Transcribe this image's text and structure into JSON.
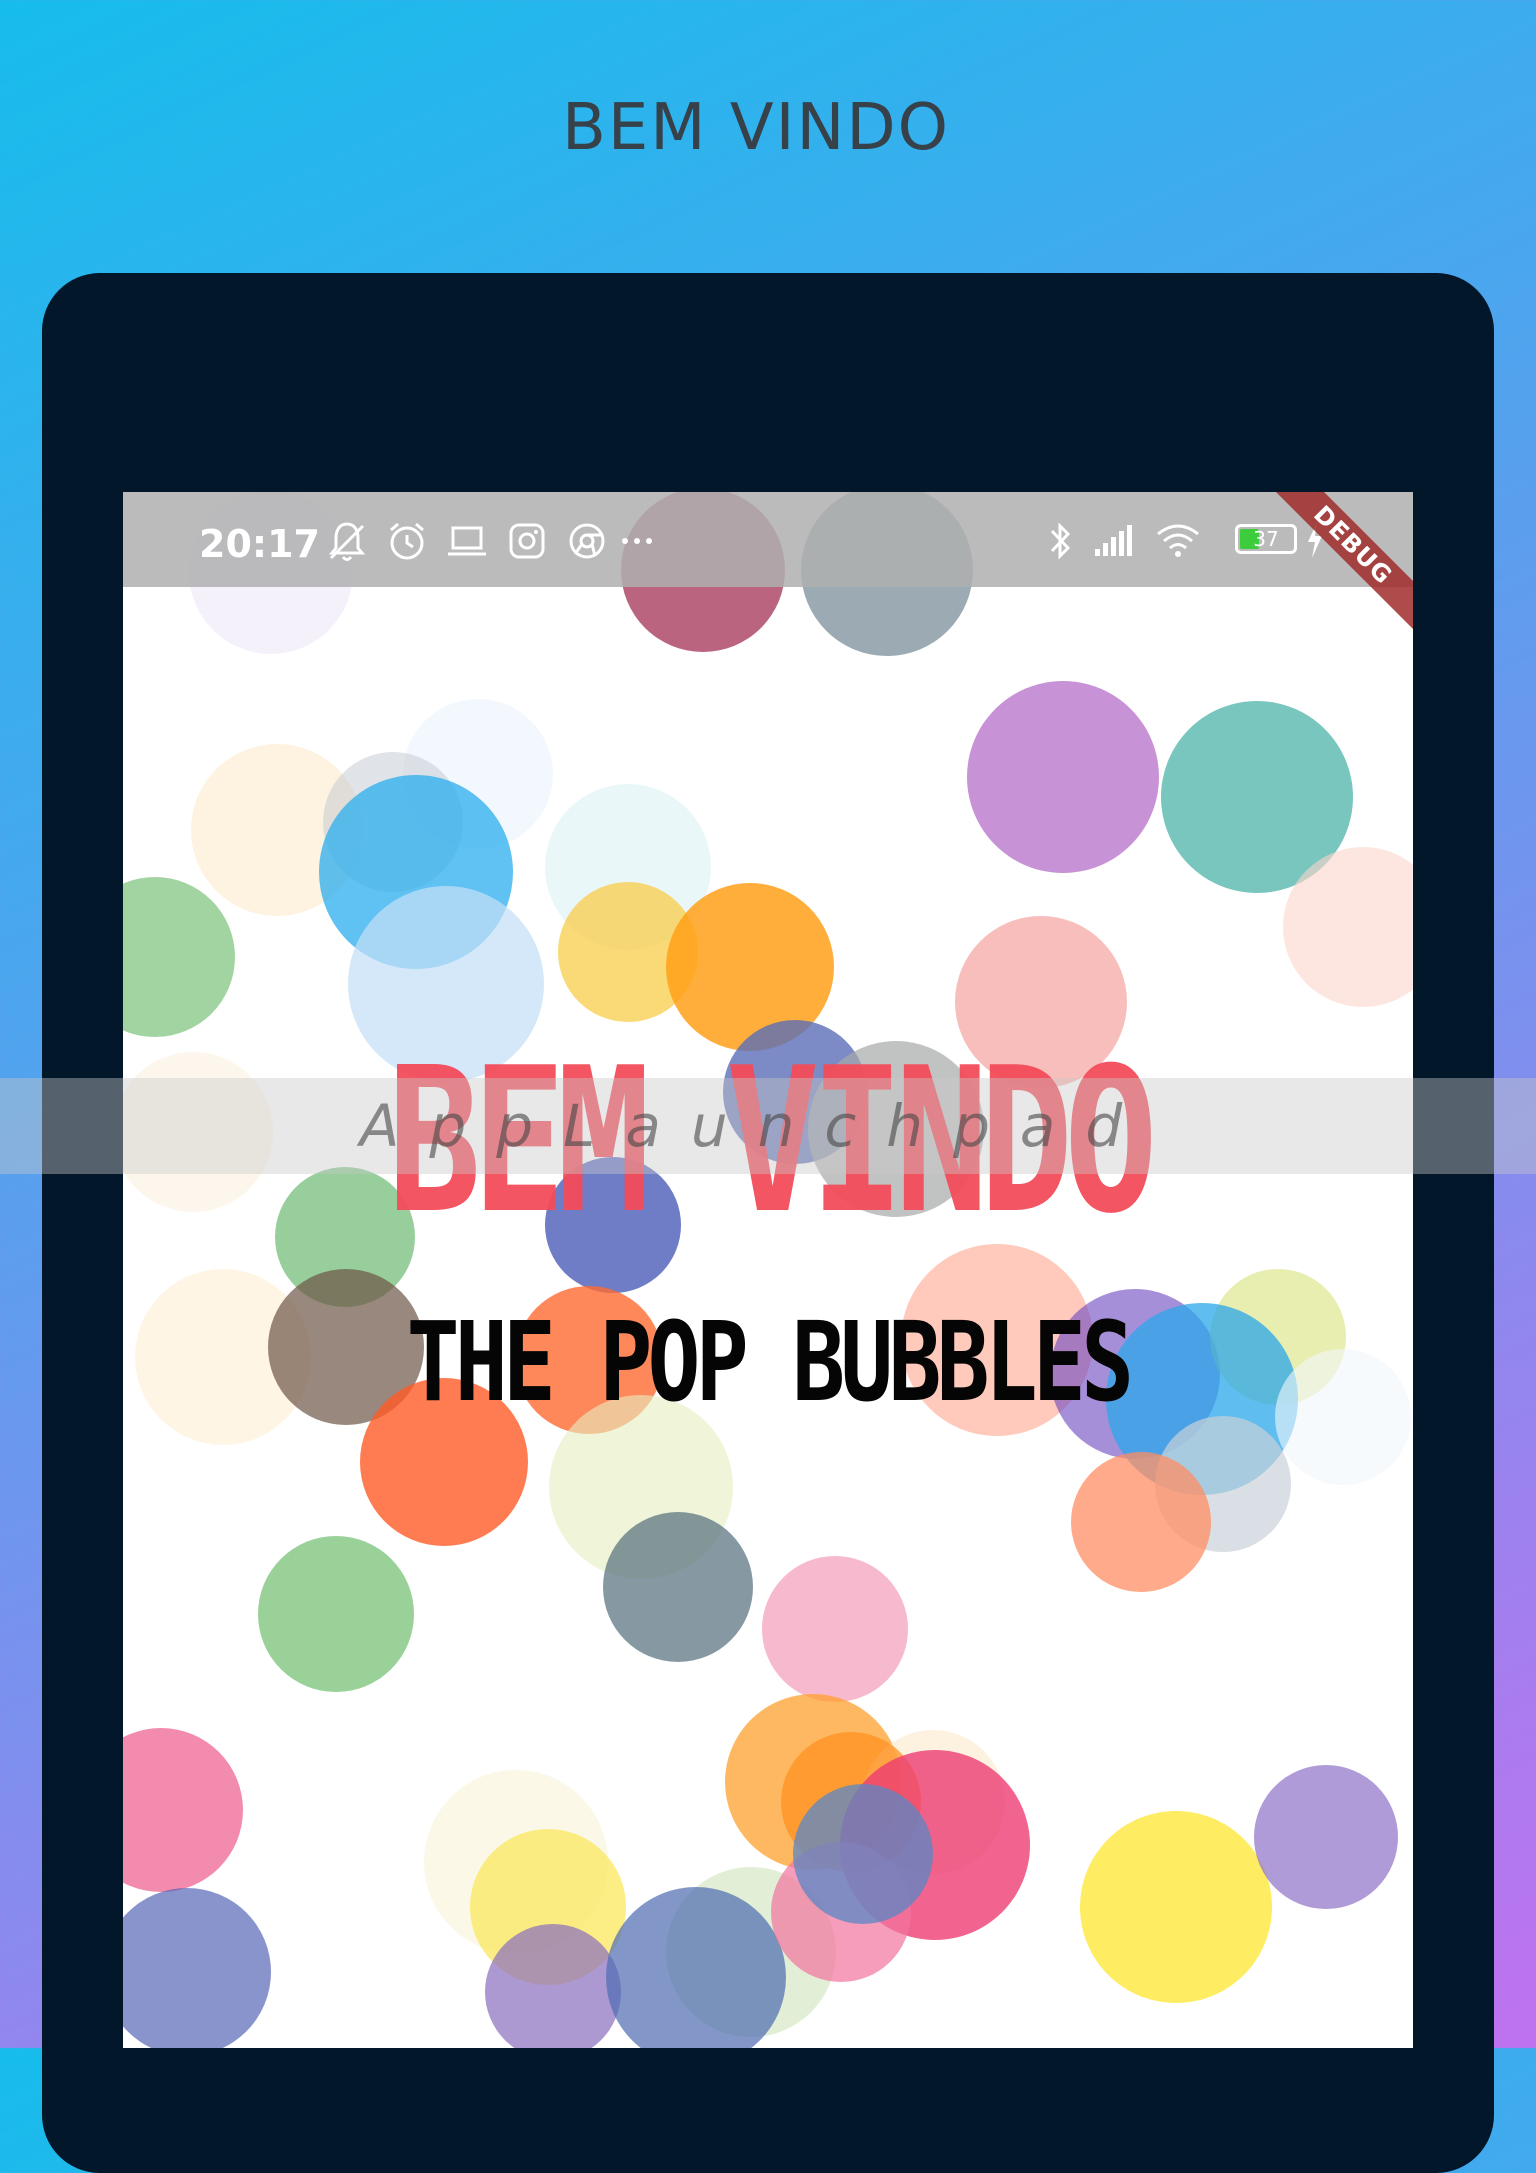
{
  "header": {
    "title": "BEM VINDO"
  },
  "status_bar": {
    "time": "20:17",
    "left_icons": [
      "mute-bell-icon",
      "alarm-clock-icon",
      "laptop-icon",
      "instagram-icon",
      "chrome-icon",
      "more-dots-icon"
    ],
    "right_icons": [
      "bluetooth-icon",
      "signal-icon",
      "wifi-icon"
    ],
    "battery_level": "37",
    "charging": true
  },
  "debug_banner": "DEBUG",
  "welcome": {
    "title": "BEM VINDO",
    "subtitle": "THE POP BUBBLES"
  },
  "watermark": "AppLaunchpad",
  "colors": {
    "title_red": "#f44c5a",
    "subtitle_black": "#050505",
    "device_frame": "#02172a",
    "background_start": "#16bdec",
    "background_end": "#c072ee"
  }
}
